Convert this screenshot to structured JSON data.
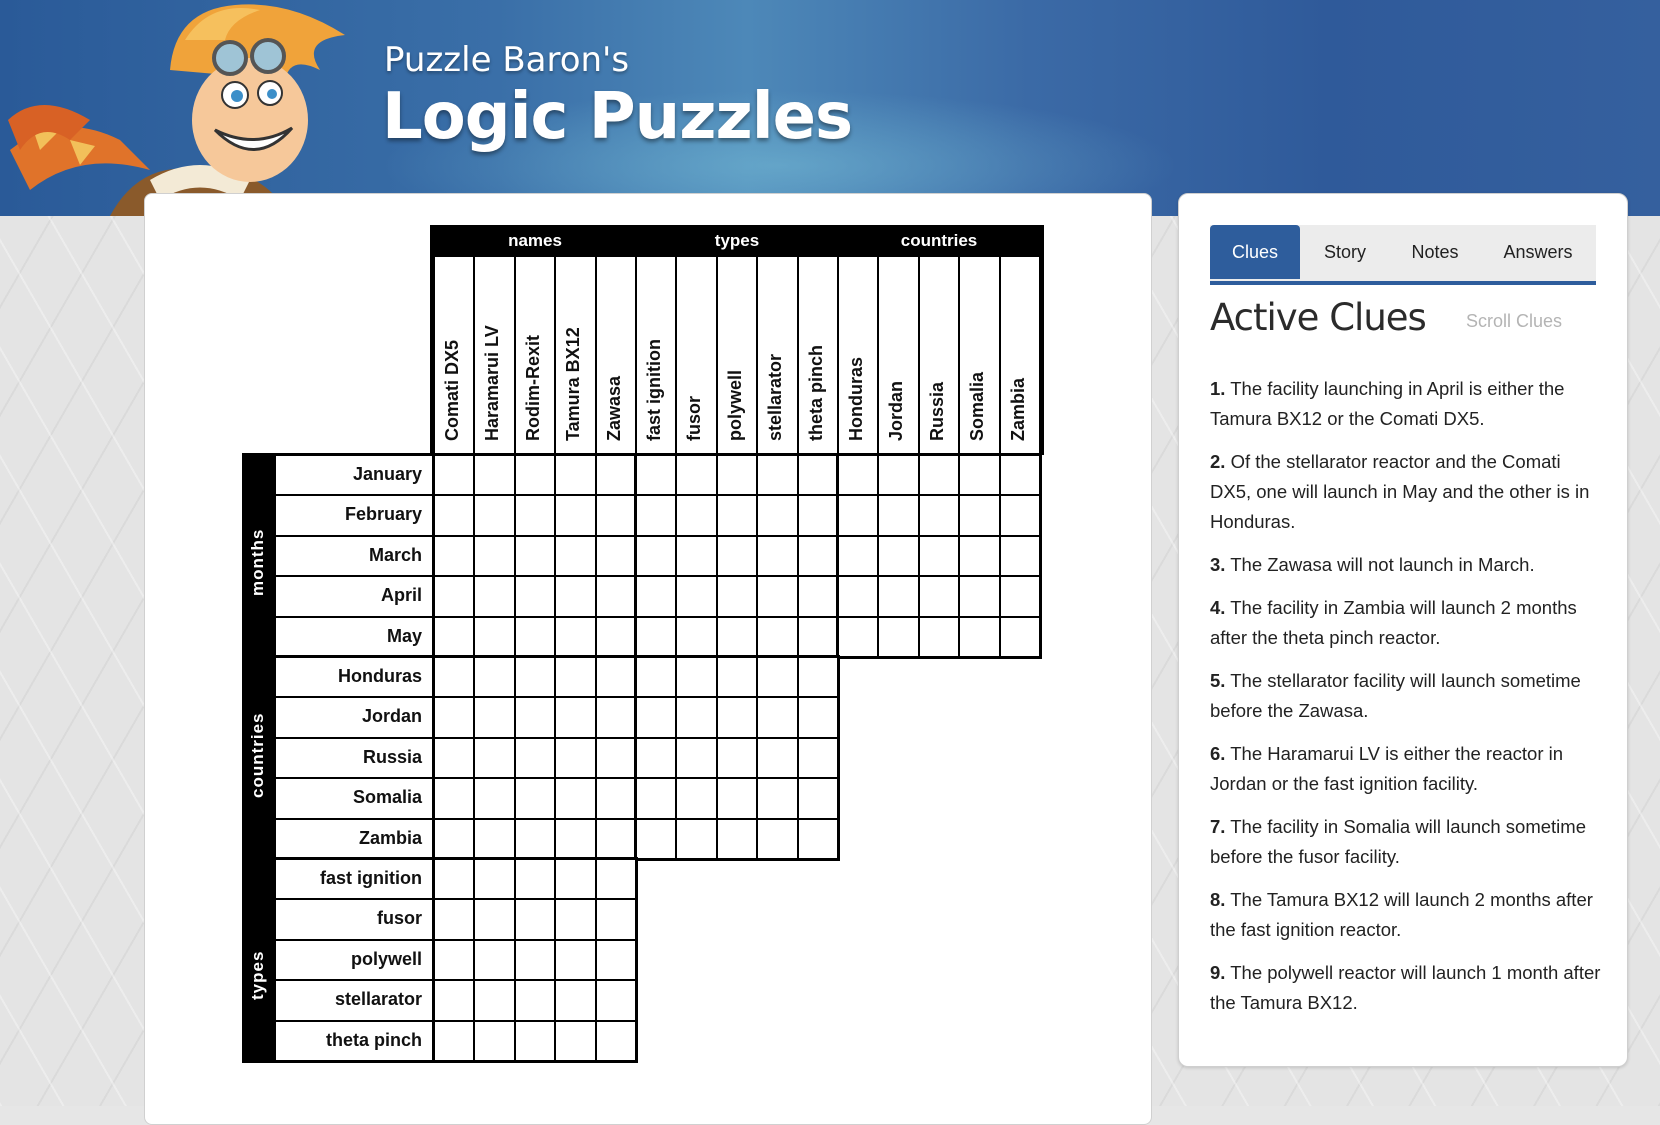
{
  "header": {
    "brand_sub": "Puzzle Baron's",
    "brand_title": "Logic Puzzles"
  },
  "tabs": [
    {
      "label": "Clues",
      "active": true
    },
    {
      "label": "Story",
      "active": false
    },
    {
      "label": "Notes",
      "active": false
    },
    {
      "label": "Answers",
      "active": false
    }
  ],
  "clues_panel": {
    "title": "Active Clues",
    "scroll_label": "Scroll Clues",
    "clues": [
      {
        "num": "1.",
        "text": "The facility launching in April is either the Tamura BX12 or the Comati DX5."
      },
      {
        "num": "2.",
        "text": "Of the stellarator reactor and the Comati DX5, one will launch in May and the other is in Honduras."
      },
      {
        "num": "3.",
        "text": "The Zawasa will not launch in March."
      },
      {
        "num": "4.",
        "text": "The facility in Zambia will launch 2 months after the theta pinch reactor."
      },
      {
        "num": "5.",
        "text": "The stellarator facility will launch sometime before the Zawasa."
      },
      {
        "num": "6.",
        "text": "The Haramarui LV is either the reactor in Jordan or the fast ignition facility."
      },
      {
        "num": "7.",
        "text": "The facility in Somalia will launch sometime before the fusor facility."
      },
      {
        "num": "8.",
        "text": "The Tamura BX12 will launch 2 months after the fast ignition reactor."
      },
      {
        "num": "9.",
        "text": "The polywell reactor will launch 1 month after the Tamura BX12."
      }
    ]
  },
  "grid": {
    "col_groups": [
      {
        "name": "names",
        "items": [
          "Comati DX5",
          "Haramarui LV",
          "Rodim-Rexit",
          "Tamura BX12",
          "Zawasa"
        ]
      },
      {
        "name": "types",
        "items": [
          "fast ignition",
          "fusor",
          "polywell",
          "stellarator",
          "theta pinch"
        ]
      },
      {
        "name": "countries",
        "items": [
          "Honduras",
          "Jordan",
          "Russia",
          "Somalia",
          "Zambia"
        ]
      }
    ],
    "row_groups": [
      {
        "name": "months",
        "items": [
          "January",
          "February",
          "March",
          "April",
          "May"
        ],
        "col_blocks": 3
      },
      {
        "name": "countries",
        "items": [
          "Honduras",
          "Jordan",
          "Russia",
          "Somalia",
          "Zambia"
        ],
        "col_blocks": 2
      },
      {
        "name": "types",
        "items": [
          "fast ignition",
          "fusor",
          "polywell",
          "stellarator",
          "theta pinch"
        ],
        "col_blocks": 1
      }
    ]
  }
}
